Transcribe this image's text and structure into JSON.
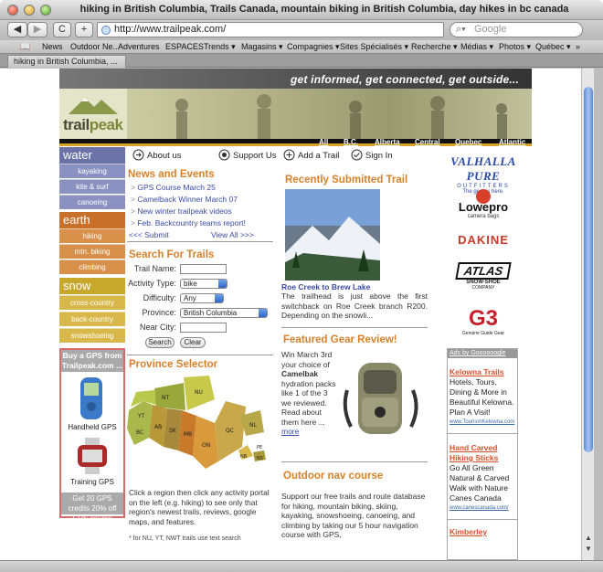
{
  "window": {
    "title": "hiking in British Columbia, Trails Canada, mountain biking in British Columbia, day hikes in bc canada"
  },
  "toolbar": {
    "back": "◀",
    "forward": "▶",
    "reload": "C",
    "add": "+",
    "url": "http://www.trailpeak.com/",
    "search_placeholder": "Google"
  },
  "bookmarks": [
    "News",
    "Outdoor Ne...",
    "Adventures",
    "ESPACES",
    "Trends ▾",
    "Magasins ▾",
    "Compagnies ▾",
    "Sites Spécialisés ▾",
    "Recherche ▾",
    "Médias ▾",
    "Photos ▾",
    "Québec ▾",
    "»"
  ],
  "tab": {
    "label": "hiking in British Columbia, ..."
  },
  "header": {
    "tagline": "get informed, get connected, get outside...",
    "logo_a": "trail",
    "logo_b": "peak"
  },
  "provinces": [
    "All",
    "B.C.",
    "Alberta",
    "Central",
    "Quebec",
    "Atlantic"
  ],
  "nav": {
    "water": {
      "label": "water",
      "items": [
        "kayaking",
        "kite & surf",
        "canoeing"
      ]
    },
    "earth": {
      "label": "earth",
      "items": [
        "hiking",
        "mtn. biking",
        "climbing"
      ]
    },
    "snow": {
      "label": "snow",
      "items": [
        "cross-country",
        "back-country",
        "snowshoeing"
      ]
    }
  },
  "gps": {
    "head": "Buy a GPS from Trailpeak.com ...",
    "handheld": "Handheld GPS",
    "training": "Training GPS",
    "foot": "Get 20 GPS credits 20% off GPS course"
  },
  "topnav": {
    "about": "About us",
    "support": "Support Us",
    "add": "Add a Trail",
    "signin": "Sign In"
  },
  "news": {
    "title": "News and Events",
    "items": [
      "GPS Course March 25",
      "Camelback Winner March 07",
      "New winter trailpeak videos",
      "Feb. Backcountry teams report!"
    ],
    "submit": "<<< Submit",
    "viewall": "View All >>>"
  },
  "search": {
    "title": "Search For Trails",
    "name_label": "Trail Name:",
    "activity_label": "Activity Type:",
    "activity_value": "bike",
    "difficulty_label": "Difficulty:",
    "difficulty_value": "Any",
    "province_label": "Province:",
    "province_value": "British Columbia",
    "city_label": "Near City:",
    "search_btn": "Search",
    "clear_btn": "Clear"
  },
  "province_selector": {
    "title": "Province Selector",
    "text": "Click a region then click any activity portal on the left (e.g. hiking) to see only that region's newest trails, reviews, google maps, and features.",
    "note": "* for NU, YT, NWT trails use text search",
    "map_labels": [
      "YT",
      "NT",
      "NU",
      "BC",
      "AB",
      "SK",
      "MB",
      "ON",
      "QC",
      "NL",
      "NB",
      "NS",
      "PE"
    ]
  },
  "recent": {
    "title": "Recently Submitted Trail",
    "link": "Roe Creek to Brew Lake",
    "text": "The trailhead is just above the first switchback on Roe Creek branch R200. Depending on the snowli..."
  },
  "gear": {
    "title": "Featured Gear Review!",
    "text_a": "Win March 3rd your choice of",
    "brand": "Camelbak",
    "text_b": "hydration packs like 1 of the 3 we reviewed. Read about them here ...",
    "more": "more"
  },
  "nav_course": {
    "title": "Outdoor nav course",
    "text": "Support our free trails and route database for hiking, mountain biking, skiing, kayaking, snowshoeing, canoeing, and climbing by taking our 5 hour navigation course with GPS,"
  },
  "sponsors": {
    "valhalla": "VALHALLA PURE",
    "valhalla_sub": "OUTFITTERS",
    "valhalla_tag": "The gear is here.",
    "lowepro": "Lowepro",
    "lowepro_sub": "camera bags",
    "dakine": "DAKINE",
    "atlas": "ATLAS",
    "atlas_sub": "SNOW-SHOE",
    "atlas_sub2": "COMPANY",
    "g3": "G3",
    "g3_sub": "Genuine Guide Gear"
  },
  "ads": {
    "head": "Ads by Goooooogle",
    "items": [
      {
        "title": "Kelowna Trails",
        "text": "Hotels, Tours, Dining & More in Beautiful Kelowna. Plan A Visit!",
        "url": "www.TourismKelowna.com"
      },
      {
        "title": "Hand Carved Hiking Sticks",
        "text": "Go All Green Natural & Carved Walk with Nature Canes Canada",
        "url": "www.canescanada.com/"
      },
      {
        "title": "Kimberley",
        "text": "",
        "url": ""
      }
    ]
  }
}
